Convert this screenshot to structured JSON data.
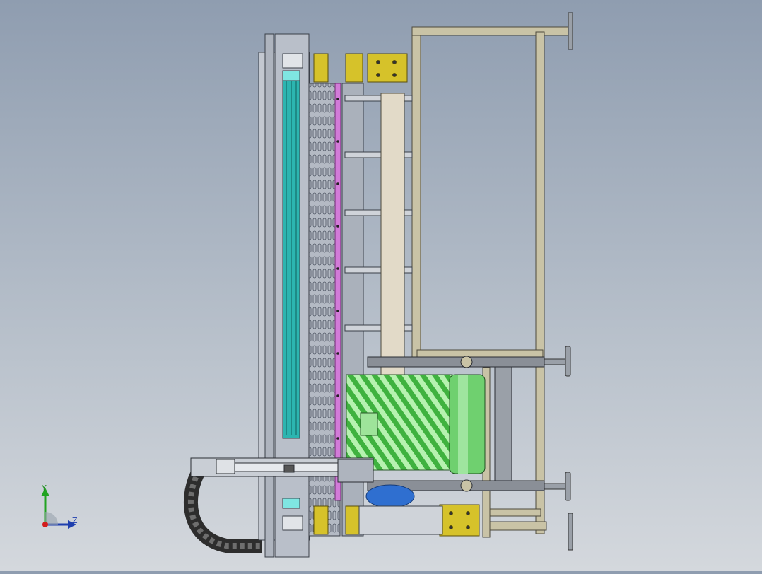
{
  "axis_triad": {
    "y_label": "Y",
    "z_label": "Z",
    "y_color": "#21a321",
    "z_color": "#1f3fae",
    "x_color": "#d21d1d"
  },
  "colors": {
    "background_top": "#8f9db0",
    "background_bottom": "#d4d8dd",
    "frame_tan": "#c9c3a6",
    "profile_gray": "#b9bfc9",
    "rail_cyan": "#2cb5b0",
    "slot_panel": "#b4bac4",
    "magenta_strip": "#d27bd8",
    "bracket_yellow": "#d6c22a",
    "beam_cream": "#e2dac8",
    "roller_green": "#6fd06f",
    "stripe_green": "#4fc14f",
    "motor_blue": "#2f6fd0",
    "chain_dark": "#3c3c3c"
  }
}
